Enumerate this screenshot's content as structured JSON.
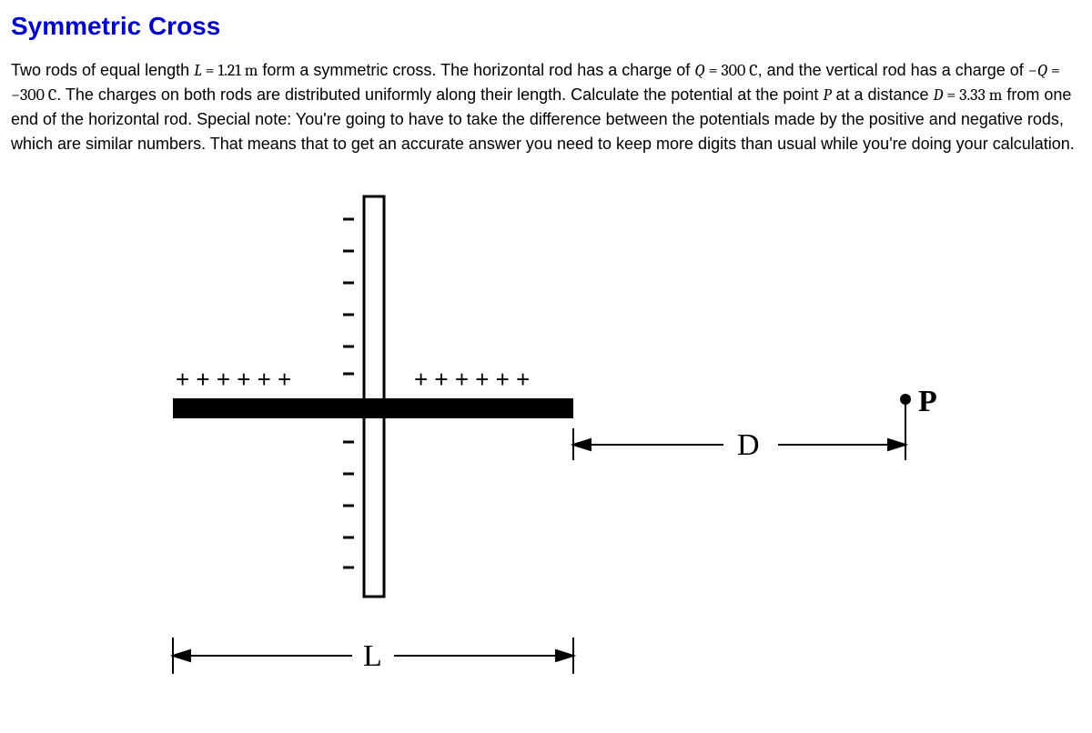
{
  "title": "Symmetric Cross",
  "problem": {
    "p1": "Two rods of equal length ",
    "L_eq": "L = 1.21 m",
    "p2": " form a symmetric cross. The horizontal rod has a charge of ",
    "Q_eq": "Q = 300 C",
    "p3": ", and the vertical rod has a charge of ",
    "negQ_eq": "−Q = −300 C",
    "p4": ". The charges on both rods are distributed uniformly along their length. Calculate the potential at the point ",
    "P_var": "P",
    "p5": " at a distance ",
    "D_eq": "D = 3.33 m",
    "p6": " from one end of the horizontal rod. Special note: You're going to have to take the difference between the potentials made by the positive and negative rods, which are similar numbers. That means that to get an accurate answer you need to keep more digits than usual while you're doing your calculation."
  },
  "diagram": {
    "plusRow": "+  +  +  +  +  +",
    "L_label": "L",
    "D_label": "D",
    "P_label": "P"
  }
}
